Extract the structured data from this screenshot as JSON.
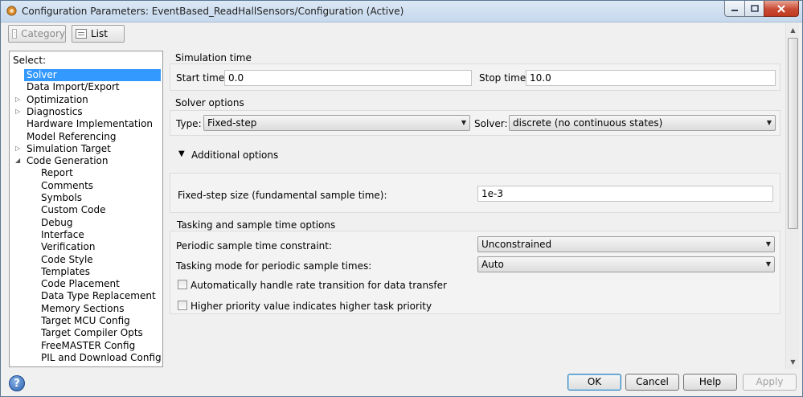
{
  "window": {
    "title": "Configuration Parameters: EventBased_ReadHallSensors/Configuration (Active)"
  },
  "toolbar": {
    "category_label": "Category",
    "list_label": "List"
  },
  "tree": {
    "select_label": "Select:",
    "items": [
      {
        "label": "Solver",
        "selected": true,
        "indent": 0,
        "expander": ""
      },
      {
        "label": "Data Import/Export",
        "indent": 0,
        "expander": ""
      },
      {
        "label": "Optimization",
        "indent": 0,
        "expander": "▷"
      },
      {
        "label": "Diagnostics",
        "indent": 0,
        "expander": "▷"
      },
      {
        "label": "Hardware Implementation",
        "indent": 0,
        "expander": ""
      },
      {
        "label": "Model Referencing",
        "indent": 0,
        "expander": ""
      },
      {
        "label": "Simulation Target",
        "indent": 0,
        "expander": "▷"
      },
      {
        "label": "Code Generation",
        "indent": 0,
        "expander": "◢"
      },
      {
        "label": "Report",
        "indent": 1,
        "expander": ""
      },
      {
        "label": "Comments",
        "indent": 1,
        "expander": ""
      },
      {
        "label": "Symbols",
        "indent": 1,
        "expander": ""
      },
      {
        "label": "Custom Code",
        "indent": 1,
        "expander": ""
      },
      {
        "label": "Debug",
        "indent": 1,
        "expander": ""
      },
      {
        "label": "Interface",
        "indent": 1,
        "expander": ""
      },
      {
        "label": "Verification",
        "indent": 1,
        "expander": ""
      },
      {
        "label": "Code Style",
        "indent": 1,
        "expander": ""
      },
      {
        "label": "Templates",
        "indent": 1,
        "expander": ""
      },
      {
        "label": "Code Placement",
        "indent": 1,
        "expander": ""
      },
      {
        "label": "Data Type Replacement",
        "indent": 1,
        "expander": ""
      },
      {
        "label": "Memory Sections",
        "indent": 1,
        "expander": ""
      },
      {
        "label": "Target MCU Config",
        "indent": 1,
        "expander": ""
      },
      {
        "label": "Target Compiler Opts",
        "indent": 1,
        "expander": ""
      },
      {
        "label": "FreeMASTER Config",
        "indent": 1,
        "expander": ""
      },
      {
        "label": "PIL and Download Config",
        "indent": 1,
        "expander": ""
      }
    ]
  },
  "simulation_time": {
    "header": "Simulation time",
    "start_label": "Start time:",
    "start_value": "0.0",
    "stop_label": "Stop time:",
    "stop_value": "10.0"
  },
  "solver_options": {
    "header": "Solver options",
    "type_label": "Type:",
    "type_value": "Fixed-step",
    "solver_label": "Solver:",
    "solver_value": "discrete (no continuous states)"
  },
  "additional_options": {
    "label": "Additional options",
    "fixed_step_label": "Fixed-step size (fundamental sample time):",
    "fixed_step_value": "1e-3"
  },
  "tasking": {
    "header": "Tasking and sample time options",
    "periodic_label": "Periodic sample time constraint:",
    "periodic_value": "Unconstrained",
    "mode_label": "Tasking mode for periodic sample times:",
    "mode_value": "Auto",
    "auto_rate_label": "Automatically handle rate transition for data transfer",
    "auto_rate_checked": false,
    "priority_label": "Higher priority value indicates higher task priority",
    "priority_checked": false
  },
  "buttons": {
    "ok": "OK",
    "cancel": "Cancel",
    "help": "Help",
    "apply": "Apply"
  }
}
